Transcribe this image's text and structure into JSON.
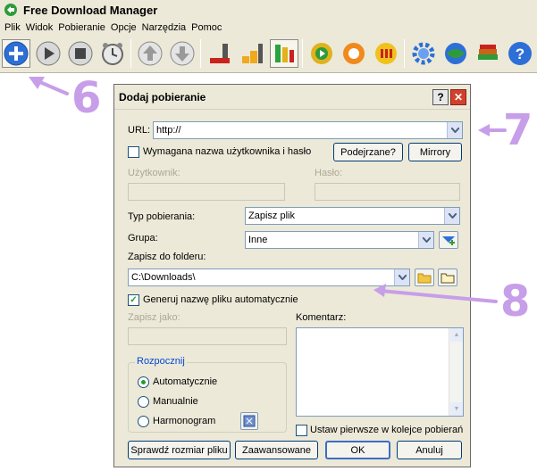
{
  "app": {
    "title": "Free Download Manager",
    "menu": [
      "Plik",
      "Widok",
      "Pobieranie",
      "Opcje",
      "Narzędzia",
      "Pomoc"
    ],
    "toolbar_icons": [
      "add-download-icon",
      "start-icon",
      "stop-icon",
      "schedule-icon",
      "move-up-icon",
      "move-down-icon",
      "download-icon-red",
      "download-icon-yellow",
      "download-list-icon",
      "refresh-icon",
      "site-manager-icon",
      "flash-video-icon",
      "settings-icon",
      "web-icon",
      "library-icon",
      "help-icon"
    ]
  },
  "dialog": {
    "title": "Dodaj pobieranie",
    "help_btn": "?",
    "close_btn": "✕",
    "url_label": "URL:",
    "url_value": "http://",
    "auth_checkbox": "Wymagana nazwa użytkownika i hasło",
    "suspicious_btn": "Podejrzane?",
    "mirrors_btn": "Mirrory",
    "user_label": "Użytkownik:",
    "password_label": "Hasło:",
    "download_type_label": "Typ pobierania:",
    "download_type_value": "Zapisz plik",
    "group_label": "Grupa:",
    "group_value": "Inne",
    "save_folder_label": "Zapisz do folderu:",
    "save_folder_value": "C:\\Downloads\\",
    "generate_name_checkbox": "Generuj nazwę pliku automatycznie",
    "save_as_label": "Zapisz jako:",
    "comment_label": "Komentarz:",
    "start_group": "Rozpocznij",
    "start_options": [
      "Automatycznie",
      "Manualnie",
      "Harmonogram"
    ],
    "queue_first_checkbox": "Ustaw pierwsze w kolejce pobierań",
    "check_size_btn": "Sprawdź rozmiar pliku",
    "advanced_btn": "Zaawansowane",
    "ok_btn": "OK",
    "cancel_btn": "Anuluj"
  },
  "annotations": {
    "label_6": "6",
    "label_7": "7",
    "label_8": "8",
    "color": "#c79ee8"
  }
}
